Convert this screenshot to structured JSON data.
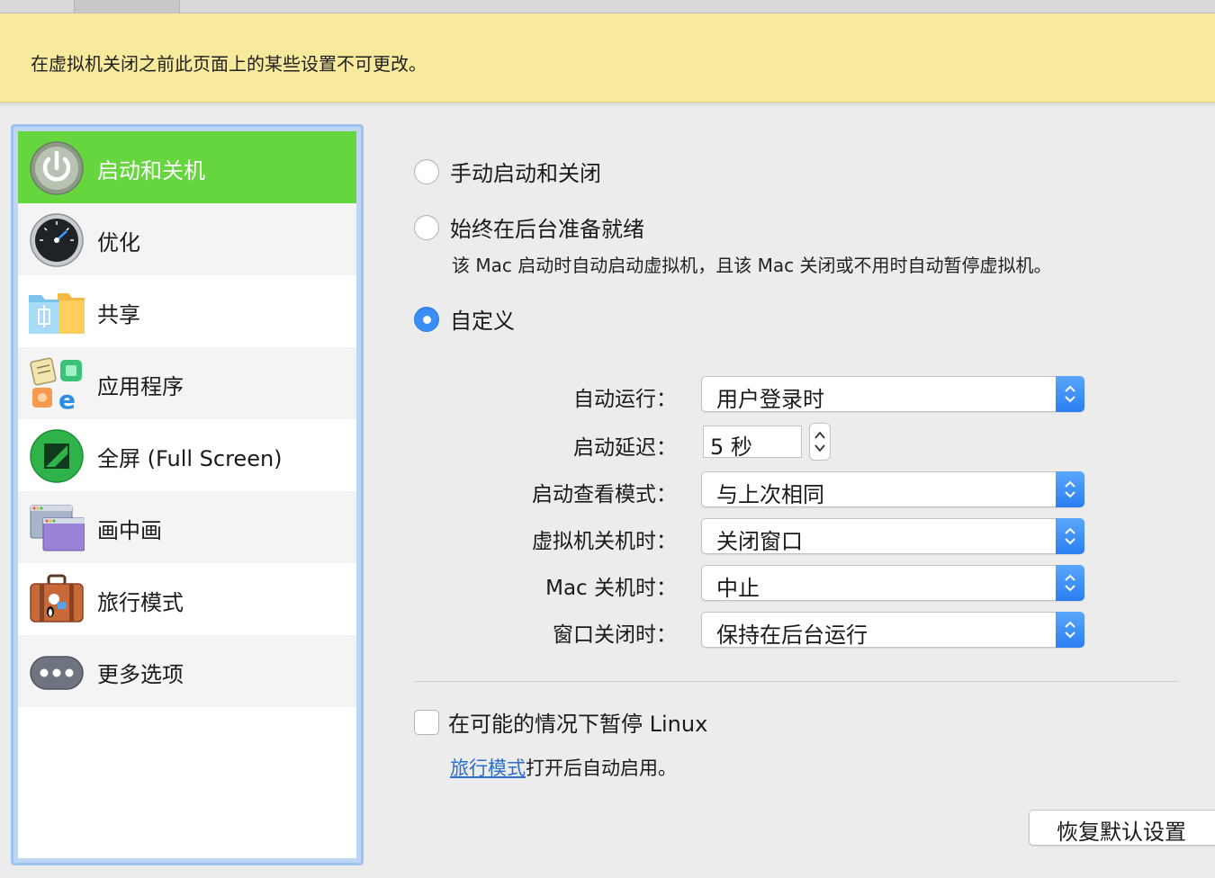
{
  "notice": "在虚拟机关闭之前此页面上的某些设置不可更改。",
  "sidebar": {
    "items": [
      {
        "label": "启动和关机",
        "icon": "power-icon",
        "selected": true
      },
      {
        "label": "优化",
        "icon": "speedometer-icon"
      },
      {
        "label": "共享",
        "icon": "shared-folder-icon"
      },
      {
        "label": "应用程序",
        "icon": "applications-icon"
      },
      {
        "label": "全屏 (Full Screen)",
        "icon": "fullscreen-icon"
      },
      {
        "label": "画中画",
        "icon": "picture-in-picture-icon"
      },
      {
        "label": "旅行模式",
        "icon": "suitcase-icon"
      },
      {
        "label": "更多选项",
        "icon": "more-options-icon"
      }
    ]
  },
  "startup": {
    "options": [
      {
        "label": "手动启动和关闭",
        "selected": false
      },
      {
        "label": "始终在后台准备就绪",
        "selected": false
      },
      {
        "label": "自定义",
        "selected": true
      }
    ],
    "always_ready_desc": "该 Mac 启动时自动启动虚拟机，且该 Mac 关闭或不用时自动暂停虚拟机。"
  },
  "settings": {
    "auto_run": {
      "label": "自动运行：",
      "value": "用户登录时"
    },
    "startup_delay": {
      "label": "启动延迟：",
      "value": "5 秒"
    },
    "view_mode": {
      "label": "启动查看模式：",
      "value": "与上次相同"
    },
    "vm_shutdown": {
      "label": "虚拟机关机时：",
      "value": "关闭窗口"
    },
    "mac_shutdown": {
      "label": "Mac 关机时：",
      "value": "中止"
    },
    "window_close": {
      "label": "窗口关闭时：",
      "value": "保持在后台运行"
    }
  },
  "pause_linux": {
    "label": "在可能的情况下暂停 Linux",
    "checked": false
  },
  "travel_note": {
    "link": "旅行模式",
    "text": "打开后自动启用。"
  },
  "reset_button": "恢复默认设置",
  "colors": {
    "accent": "#3a8ef6",
    "selected_item": "#66d63f",
    "notice_bg": "#f8ea9c"
  }
}
